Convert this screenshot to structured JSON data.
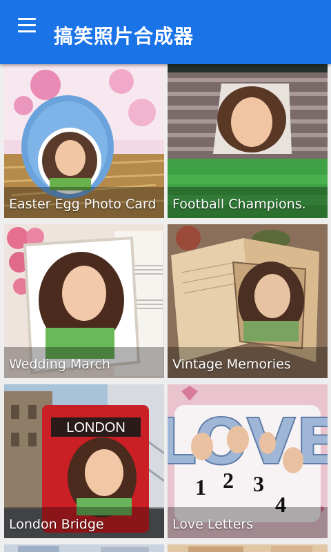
{
  "app": {
    "title": "搞笑照片合成器"
  },
  "tiles": [
    {
      "label": "Easter Egg Photo Card"
    },
    {
      "label": "Football Champions."
    },
    {
      "label": "Wedding March"
    },
    {
      "label": "Vintage Memories"
    },
    {
      "label": "London Bridge"
    },
    {
      "label": "Love Letters"
    }
  ],
  "thumbnail_text": {
    "bus_sign": "LONDON",
    "love_word": "LOVE",
    "love_numbers": [
      "1",
      "2",
      "3",
      "4"
    ]
  },
  "colors": {
    "appbar": "#1b73e8",
    "caption_overlay": "rgba(0,0,0,0.30)"
  },
  "icons": {
    "menu": "hamburger-menu-icon"
  }
}
